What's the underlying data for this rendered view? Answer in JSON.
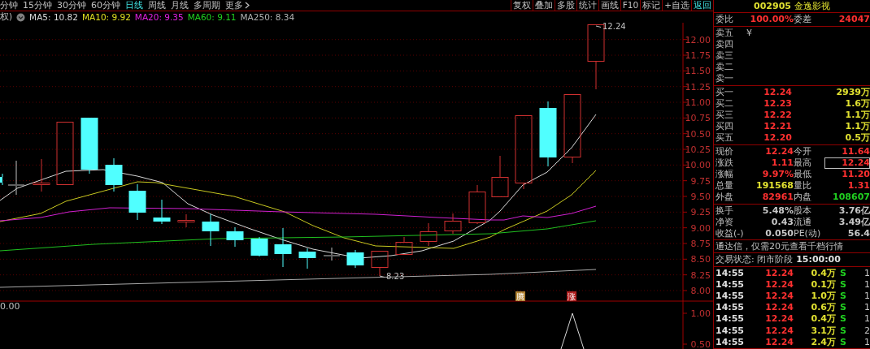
{
  "nav_tabs": [
    {
      "label": "分钟",
      "selected": false,
      "kind": "tab"
    },
    {
      "label": "15分钟",
      "selected": false,
      "kind": "tab"
    },
    {
      "label": "30分钟",
      "selected": false,
      "kind": "tab"
    },
    {
      "label": "60分钟",
      "selected": false,
      "kind": "tab"
    },
    {
      "label": "日线",
      "selected": true,
      "kind": "tab"
    },
    {
      "label": "周线",
      "selected": false,
      "kind": "tab"
    },
    {
      "label": "月线",
      "selected": false,
      "kind": "tab"
    },
    {
      "label": "多周期",
      "selected": false,
      "kind": "tab"
    },
    {
      "label": "更多",
      "selected": false,
      "kind": "menu"
    }
  ],
  "toolbar_buttons": [
    {
      "label": "复权",
      "selected": false
    },
    {
      "label": "叠加",
      "selected": false
    },
    {
      "label": "多股",
      "selected": false
    },
    {
      "label": "统计",
      "selected": false
    },
    {
      "label": "画线",
      "selected": false
    },
    {
      "label": "F10",
      "selected": false
    },
    {
      "label": "标记",
      "selected": false
    },
    {
      "label": "+自选",
      "selected": false
    },
    {
      "label": "返回",
      "selected": true
    }
  ],
  "indicator_legend": {
    "prefix": "权)",
    "items": [
      {
        "label": "MA5: 10.82",
        "color": "#d8d8d8"
      },
      {
        "label": "MA10: 9.92",
        "color": "#e0e020"
      },
      {
        "label": "MA20: 9.35",
        "color": "#e020e0"
      },
      {
        "label": "MA60: 9.11",
        "color": "#20d020"
      },
      {
        "label": "MA250: 8.34",
        "color": "#b0b0b0"
      }
    ]
  },
  "chart": {
    "price_axis": [
      "12.00",
      "11.75",
      "11.50",
      "11.25",
      "11.00",
      "10.75",
      "10.50",
      "10.25",
      "10.00",
      "9.75",
      "9.50",
      "9.25",
      "9.00",
      "8.75",
      "8.50",
      "8.25",
      "8.00"
    ],
    "high_label": "12.24",
    "low_label": "8.23",
    "signals": [
      {
        "label": "腾",
        "color": "#b08030"
      },
      {
        "label": "涨",
        "color": "#b02020"
      }
    ],
    "volume_base_label": "0.00",
    "volume_axis": [
      "1.00",
      "0.50"
    ]
  },
  "quote": {
    "code": "002905",
    "name": "金逸影视",
    "order_ratio": {
      "label": "委比",
      "value": "100.00%",
      "label_2": "委差",
      "value_2": "24047"
    },
    "asks": [
      {
        "label": "卖五",
        "mark": "¥"
      },
      {
        "label": "卖四"
      },
      {
        "label": "卖三"
      },
      {
        "label": "卖二"
      },
      {
        "label": "卖一"
      }
    ],
    "bids": [
      {
        "label": "买一",
        "price": "12.24",
        "volume": "2939万"
      },
      {
        "label": "买二",
        "price": "12.23",
        "volume": "1.6万"
      },
      {
        "label": "买三",
        "price": "12.22",
        "volume": "1.1万"
      },
      {
        "label": "买四",
        "price": "12.21",
        "volume": "1.1万"
      },
      {
        "label": "买五",
        "price": "12.20",
        "volume": "0.5万"
      }
    ],
    "stats": [
      {
        "label": "现价",
        "value": "12.24",
        "color": "#ff3030",
        "boxed": false
      },
      {
        "label": "今开",
        "value": "11.64",
        "color": "#ff3030",
        "boxed": false
      },
      {
        "label": "涨跌",
        "value": "1.11",
        "color": "#ff3030",
        "boxed": false
      },
      {
        "label": "最高",
        "value": "12.24",
        "color": "#ff3030",
        "boxed": true
      },
      {
        "label": "涨幅",
        "value": "9.97%",
        "color": "#ff3030",
        "boxed": false
      },
      {
        "label": "最低",
        "value": "11.20",
        "color": "#ff3030",
        "boxed": false
      },
      {
        "label": "总量",
        "value": "191568",
        "color": "#e0e030",
        "boxed": false
      },
      {
        "label": "量比",
        "value": "1.31",
        "color": "#ff3030",
        "boxed": false
      },
      {
        "label": "外盘",
        "value": "82961",
        "color": "#ff3030",
        "boxed": false
      },
      {
        "label": "内盘",
        "value": "108607",
        "color": "#20d020",
        "boxed": false
      }
    ],
    "fundamentals": [
      {
        "label": "换手",
        "value": "5.48%"
      },
      {
        "label": "股本",
        "value": "3.76亿"
      },
      {
        "label": "净资",
        "value": "0.43"
      },
      {
        "label": "流通",
        "value": "3.49亿"
      },
      {
        "label": "收益(-)",
        "value": "0.050"
      },
      {
        "label": "PE(动)",
        "value": "56.4"
      }
    ],
    "notice": "通达信，仅需20元查看千档行情",
    "trade_status": {
      "label": "交易状态: 闭市阶段",
      "time": "15:00:00"
    },
    "ticks": [
      {
        "time": "14:55",
        "price": "12.24",
        "volume": "0.4万",
        "side": "S",
        "column_5": "1"
      },
      {
        "time": "14:55",
        "price": "12.24",
        "volume": "0.1万",
        "side": "S",
        "column_5": "1"
      },
      {
        "time": "14:55",
        "price": "12.24",
        "volume": "1.0万",
        "side": "S",
        "column_5": "1"
      },
      {
        "time": "14:55",
        "price": "12.24",
        "volume": "0.6万",
        "side": "S",
        "column_5": "1"
      },
      {
        "time": "14:55",
        "price": "12.24",
        "volume": "0.4万",
        "side": "S",
        "column_5": "1"
      },
      {
        "time": "14:55",
        "price": "12.24",
        "volume": "3.1万",
        "side": "S",
        "column_5": "2"
      },
      {
        "time": "14:55",
        "price": "12.24",
        "volume": "2.4万",
        "side": "S",
        "column_5": "1"
      }
    ]
  }
}
